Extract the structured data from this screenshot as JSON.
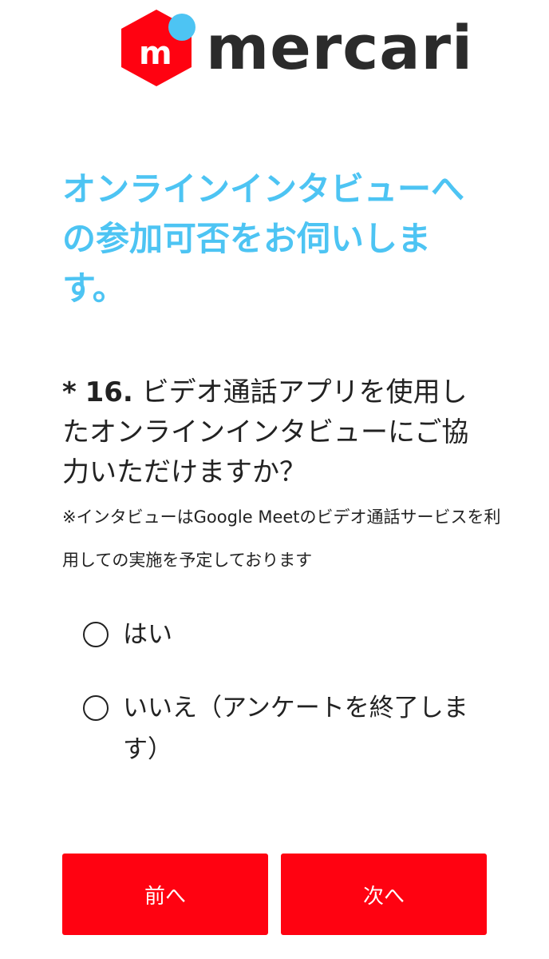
{
  "brand": {
    "logo_letter": "m",
    "wordmark": "mercari",
    "colors": {
      "logo_red": "#ff0211",
      "logo_dot": "#4dc4f3",
      "title_blue": "#4dc4f3",
      "button_red": "#ff0211"
    }
  },
  "page": {
    "title": "オンラインインタビューへの参加可否をお伺いします。"
  },
  "question": {
    "required_mark": "*",
    "number": "16.",
    "text": "ビデオ通話アプリを使用したオンラインインタビューにご協力いただけますか？",
    "note": "※インタビューはGoogle Meetのビデオ通話サービスを利用しての実施を予定しております"
  },
  "options": [
    {
      "label": "はい",
      "selected": false
    },
    {
      "label": "いいえ（アンケートを終了します）",
      "selected": false
    }
  ],
  "buttons": {
    "prev_label": "前へ",
    "next_label": "次へ"
  }
}
